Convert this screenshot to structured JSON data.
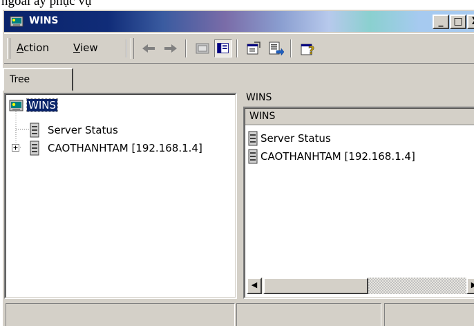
{
  "caption": "ngoài ấy phục vụ",
  "window": {
    "title": "WINS",
    "controls": {
      "minimize": "_",
      "maximize": "□",
      "close": "X"
    }
  },
  "menu": [
    {
      "label": "Action",
      "key": "A"
    },
    {
      "label": "View",
      "key": "V"
    }
  ],
  "toolbar_icons": [
    "back-arrow-icon",
    "forward-arrow-icon",
    "up-level-icon",
    "show-hide-tree-icon",
    "properties-icon",
    "export-list-icon",
    "help-icon"
  ],
  "tree": {
    "tab_label": "Tree",
    "root": "WINS",
    "items": [
      {
        "label": "Server Status",
        "icon": "server-icon",
        "expandable": false
      },
      {
        "label": "CAOTHANHTAM [192.168.1.4]",
        "icon": "server-icon",
        "expandable": true
      }
    ]
  },
  "details": {
    "header": "WINS",
    "column": "WINS",
    "items": [
      {
        "label": "Server Status",
        "icon": "server-icon"
      },
      {
        "label": "CAOTHANHTAM [192.168.1.4]",
        "icon": "server-icon"
      }
    ]
  },
  "colors": {
    "title_active": "#0a246a",
    "face": "#d4d0c8",
    "selection": "#0a246a"
  }
}
